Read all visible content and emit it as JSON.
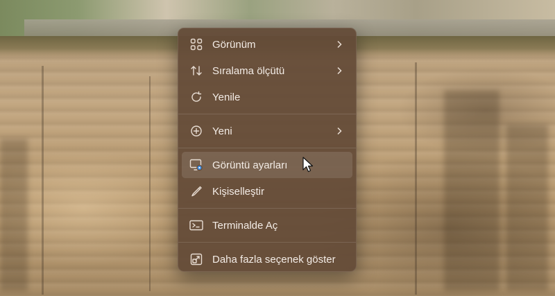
{
  "desktop": {
    "wallpaper": "cliff-landscape"
  },
  "context_menu": {
    "items": [
      {
        "label": "Görünüm",
        "icon": "grid-view-icon",
        "has_submenu": true
      },
      {
        "label": "Sıralama ölçütü",
        "icon": "sort-arrows-icon",
        "has_submenu": true
      },
      {
        "label": "Yenile",
        "icon": "refresh-icon",
        "has_submenu": false
      },
      {
        "label": "Yeni",
        "icon": "new-plus-circle-icon",
        "has_submenu": true
      },
      {
        "label": "Görüntü ayarları",
        "icon": "display-settings-icon",
        "has_submenu": false,
        "hovered": true
      },
      {
        "label": "Kişiselleştir",
        "icon": "pen-brush-icon",
        "has_submenu": false
      },
      {
        "label": "Terminalde Aç",
        "icon": "terminal-icon",
        "has_submenu": false
      },
      {
        "label": "Daha fazla seçenek göster",
        "icon": "more-options-icon",
        "has_submenu": false
      }
    ]
  },
  "colors": {
    "menu_background": "#634a37",
    "menu_text": "#f3ece6",
    "accent": "#3b8be0"
  }
}
